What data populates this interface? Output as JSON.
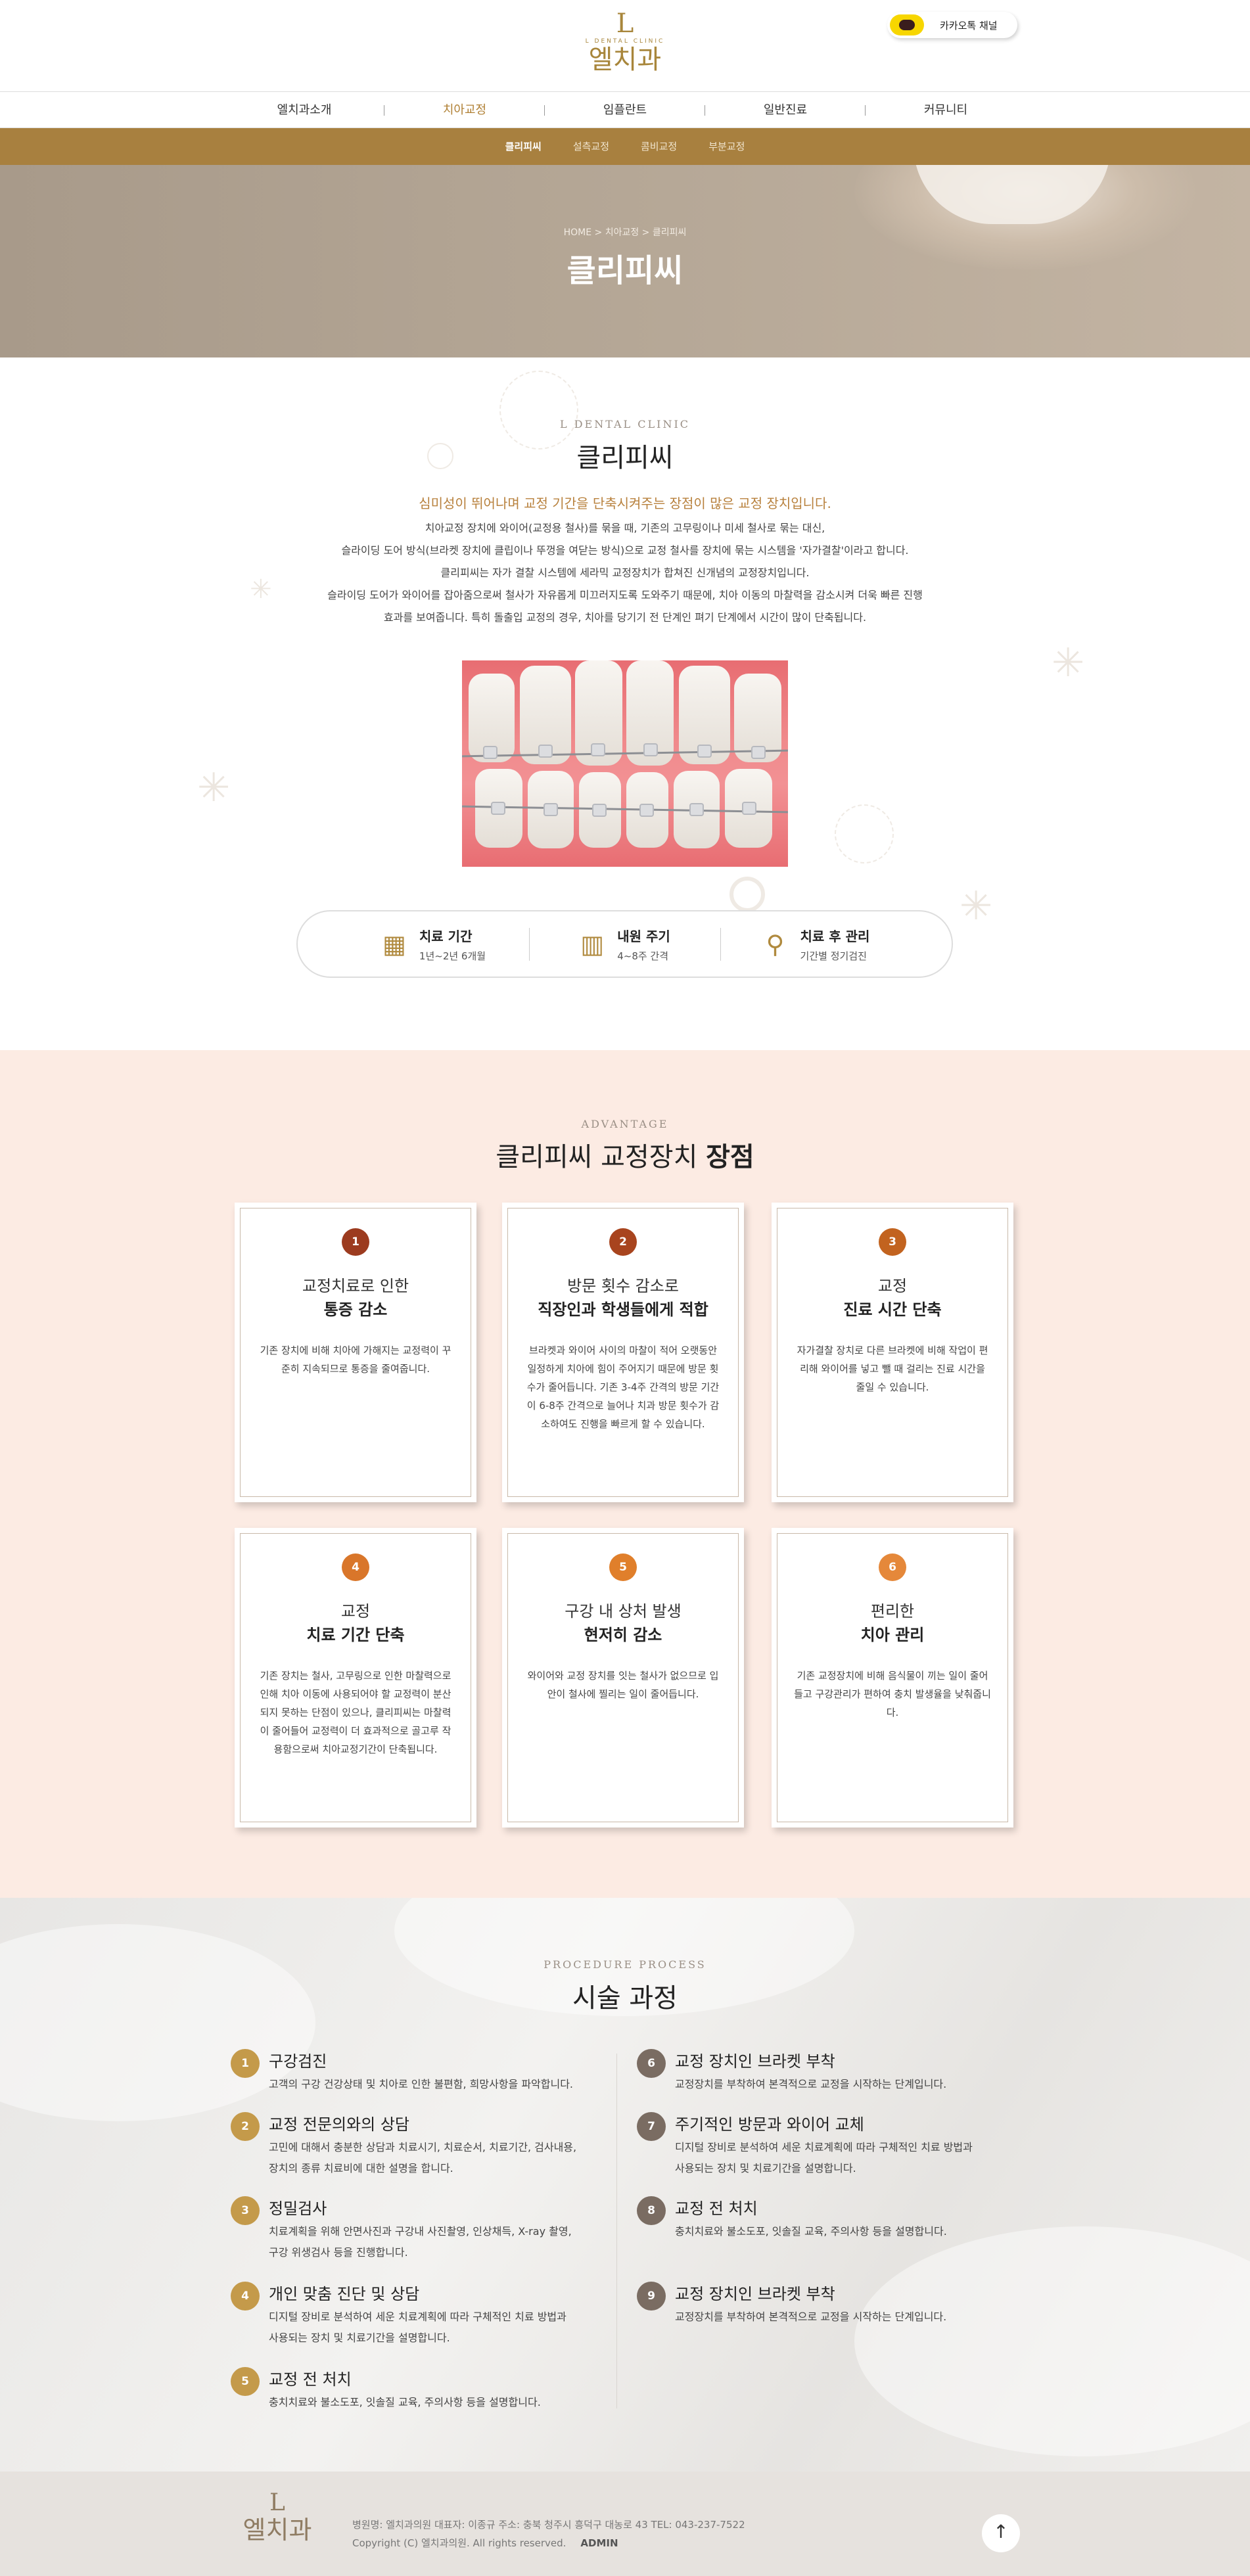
{
  "header": {
    "logo_mark": "L",
    "logo_sub": "L DENTAL CLINIC",
    "logo_name": "엘치과",
    "kakao_label": "카카오톡 채널"
  },
  "nav": {
    "items": [
      "엘치과소개",
      "치아교정",
      "임플란트",
      "일반진료",
      "커뮤니티"
    ],
    "active": "치아교정"
  },
  "subnav": {
    "items": [
      "클리피씨",
      "설측교정",
      "콤비교정",
      "부분교정"
    ]
  },
  "hero": {
    "breadcrumb": "HOME > 치아교정 > 클리피씨",
    "title": "클리피씨"
  },
  "intro": {
    "eyebrow": "L DENTAL CLINIC",
    "title": "클리피씨",
    "lead": "심미성이 뛰어나며 교정 기간을 단축시켜주는 장점이 많은 교정 장치입니다.",
    "lines": [
      "치아교정 장치에 와이어(교정용 철사)를 묶을 때, 기존의 고무링이나 미세 철사로 묶는 대신,",
      "슬라이딩 도어 방식(브라켓 장치에 클립이나 뚜껑을 여닫는 방식)으로 교정 철사를 장치에 묶는 시스템을 '자가결찰'이라고 합니다.",
      "클리피씨는 자가 결찰 시스템에 세라믹 교정장치가 합쳐진 신개념의 교정장치입니다.",
      "슬라이딩 도어가 와이어를 잡아줌으로써 철사가 자유롭게 미끄러지도록 도와주기 때문에, 치아 이동의 마찰력을 감소시켜 더욱 빠른 진행",
      "효과를 보여줍니다. 특히 돌출입 교정의 경우, 치아를 당기기 전 단계인 펴기 단계에서 시간이 많이 단축됩니다."
    ]
  },
  "info": [
    {
      "icon": "calendar-icon",
      "title": "치료 기간",
      "desc": "1년~2년 6개월"
    },
    {
      "icon": "schedule-icon",
      "title": "내원 주기",
      "desc": "4~8주 간격"
    },
    {
      "icon": "tools-icon",
      "title": "치료 후 관리",
      "desc": "기간별 정기검진"
    }
  ],
  "advantage": {
    "eyebrow": "ADVANTAGE",
    "title_normal": "클리피씨 교정장치 ",
    "title_bold": "장점",
    "cards": [
      {
        "num": "1",
        "color": "#9c3b1f",
        "h1": "교정치료로 인한",
        "h2": "통증 감소",
        "body": "기존 장치에 비해 치아에 가해지는 교정력이 꾸준히 지속되므로 통증을 줄여줍니다."
      },
      {
        "num": "2",
        "color": "#a8441e",
        "h1": "방문 횟수 감소로",
        "h2": "직장인과 학생들에게 적합",
        "body": "브라켓과 와이어 사이의 마찰이 적어 오랫동안 일정하게 치아에 힘이 주어지기 때문에 방문 횟수가 줄어듭니다. 기존 3-4주 간격의 방문 기간이 6-8주 간격으로 늘어나 치과 방문 횟수가 감소하여도 진행을 빠르게 할 수 있습니다."
      },
      {
        "num": "3",
        "color": "#c2631f",
        "h1": "교정",
        "h2": "진료 시간 단축",
        "body": "자가결찰 장치로 다른 브라켓에 비해 작업이 편리해 와이어를 넣고 뺄 때 걸리는 진료 시간을 줄일 수 있습니다."
      },
      {
        "num": "4",
        "color": "#d9762a",
        "h1": "교정",
        "h2": "치료 기간 단축",
        "body": "기존 장치는 철사, 고무링으로 인한 마찰력으로 인해 치아 이동에 사용되어야 할 교정력이 분산되지 못하는 단점이 있으나, 클리피씨는 마찰력이 줄어들어 교정력이 더 효과적으로 골고루 작용함으로써 치아교정기간이 단축됩니다."
      },
      {
        "num": "5",
        "color": "#e07f2b",
        "h1": "구강 내 상처 발생",
        "h2": "현저히 감소",
        "body": "와이어와 교정 장치를 잇는 철사가 없으므로 입 안이 철사에 찔리는 일이 줄어듭니다."
      },
      {
        "num": "6",
        "color": "#e5883a",
        "h1": "편리한",
        "h2": "치아 관리",
        "body": "기존 교정장치에 비해 음식물이 끼는 일이 줄어들고 구강관리가 편하여 충치 발생율을 낮춰줍니다."
      }
    ]
  },
  "process": {
    "eyebrow": "PROCEDURE PROCESS",
    "title": "시술 과정",
    "left": [
      {
        "num": "1",
        "title": "구강검진",
        "desc": [
          "고객의 구강 건강상태 및 치아로 인한 불편함, 희망사항을 파악합니다."
        ]
      },
      {
        "num": "2",
        "title": "교정 전문의와의 상담",
        "desc": [
          "고민에 대해서 충분한 상담과 치료시기, 치료순서, 치료기간, 검사내용,",
          "장치의 종류 치료비에 대한 설명을 합니다."
        ]
      },
      {
        "num": "3",
        "title": "정밀검사",
        "desc": [
          "치료계획을 위해 안면사진과 구강내 사진촬영, 인상채득, X-ray 촬영,",
          "구강 위생검사 등을 진행합니다."
        ]
      },
      {
        "num": "4",
        "title": "개인 맞춤 진단 및 상담",
        "desc": [
          "디지털 장비로 분석하여 세운 치료계획에 따라 구체적인 치료 방법과",
          "사용되는 장치 및 치료기간을 설명합니다."
        ]
      },
      {
        "num": "5",
        "title": "교정 전 처치",
        "desc": [
          "충치치료와 불소도포, 잇솔질 교육, 주의사항 등을 설명합니다."
        ]
      }
    ],
    "right": [
      {
        "num": "6",
        "title": "교정 장치인 브라켓 부착",
        "desc": [
          "교정장치를 부착하여 본격적으로 교정을 시작하는 단계입니다."
        ]
      },
      {
        "num": "7",
        "title": "주기적인 방문과 와이어 교체",
        "desc": [
          "디지털 장비로 분석하여 세운 치료계획에 따라 구체적인 치료 방법과",
          "사용되는 장치 및 치료기간을 설명합니다."
        ]
      },
      {
        "num": "8",
        "title": "교정 전 처치",
        "desc": [
          "충치치료와 불소도포, 잇솔질 교육, 주의사항 등을 설명합니다."
        ]
      },
      {
        "num": "9",
        "title": "교정 장치인 브라켓 부착",
        "desc": [
          "교정장치를 부착하여 본격적으로 교정을 시작하는 단계입니다."
        ]
      }
    ]
  },
  "footer": {
    "logo_mark": "L",
    "logo_name": "엘치과",
    "info": "병원명: 엘치과의원   대표자: 이종규   주소: 충북 청주시 흥덕구 대농로 43   TEL: 043-237-7522",
    "copyright": "Copyright (C) 엘치과의원. All rights reserved.",
    "admin": "ADMIN",
    "top_icon": "arrow-up-icon"
  },
  "colors": {
    "gold": "#a8803f",
    "accent_orange": "#b8813d",
    "proc_num_gold": "#c49a4a",
    "proc_num_gray": "#7a6c62"
  }
}
